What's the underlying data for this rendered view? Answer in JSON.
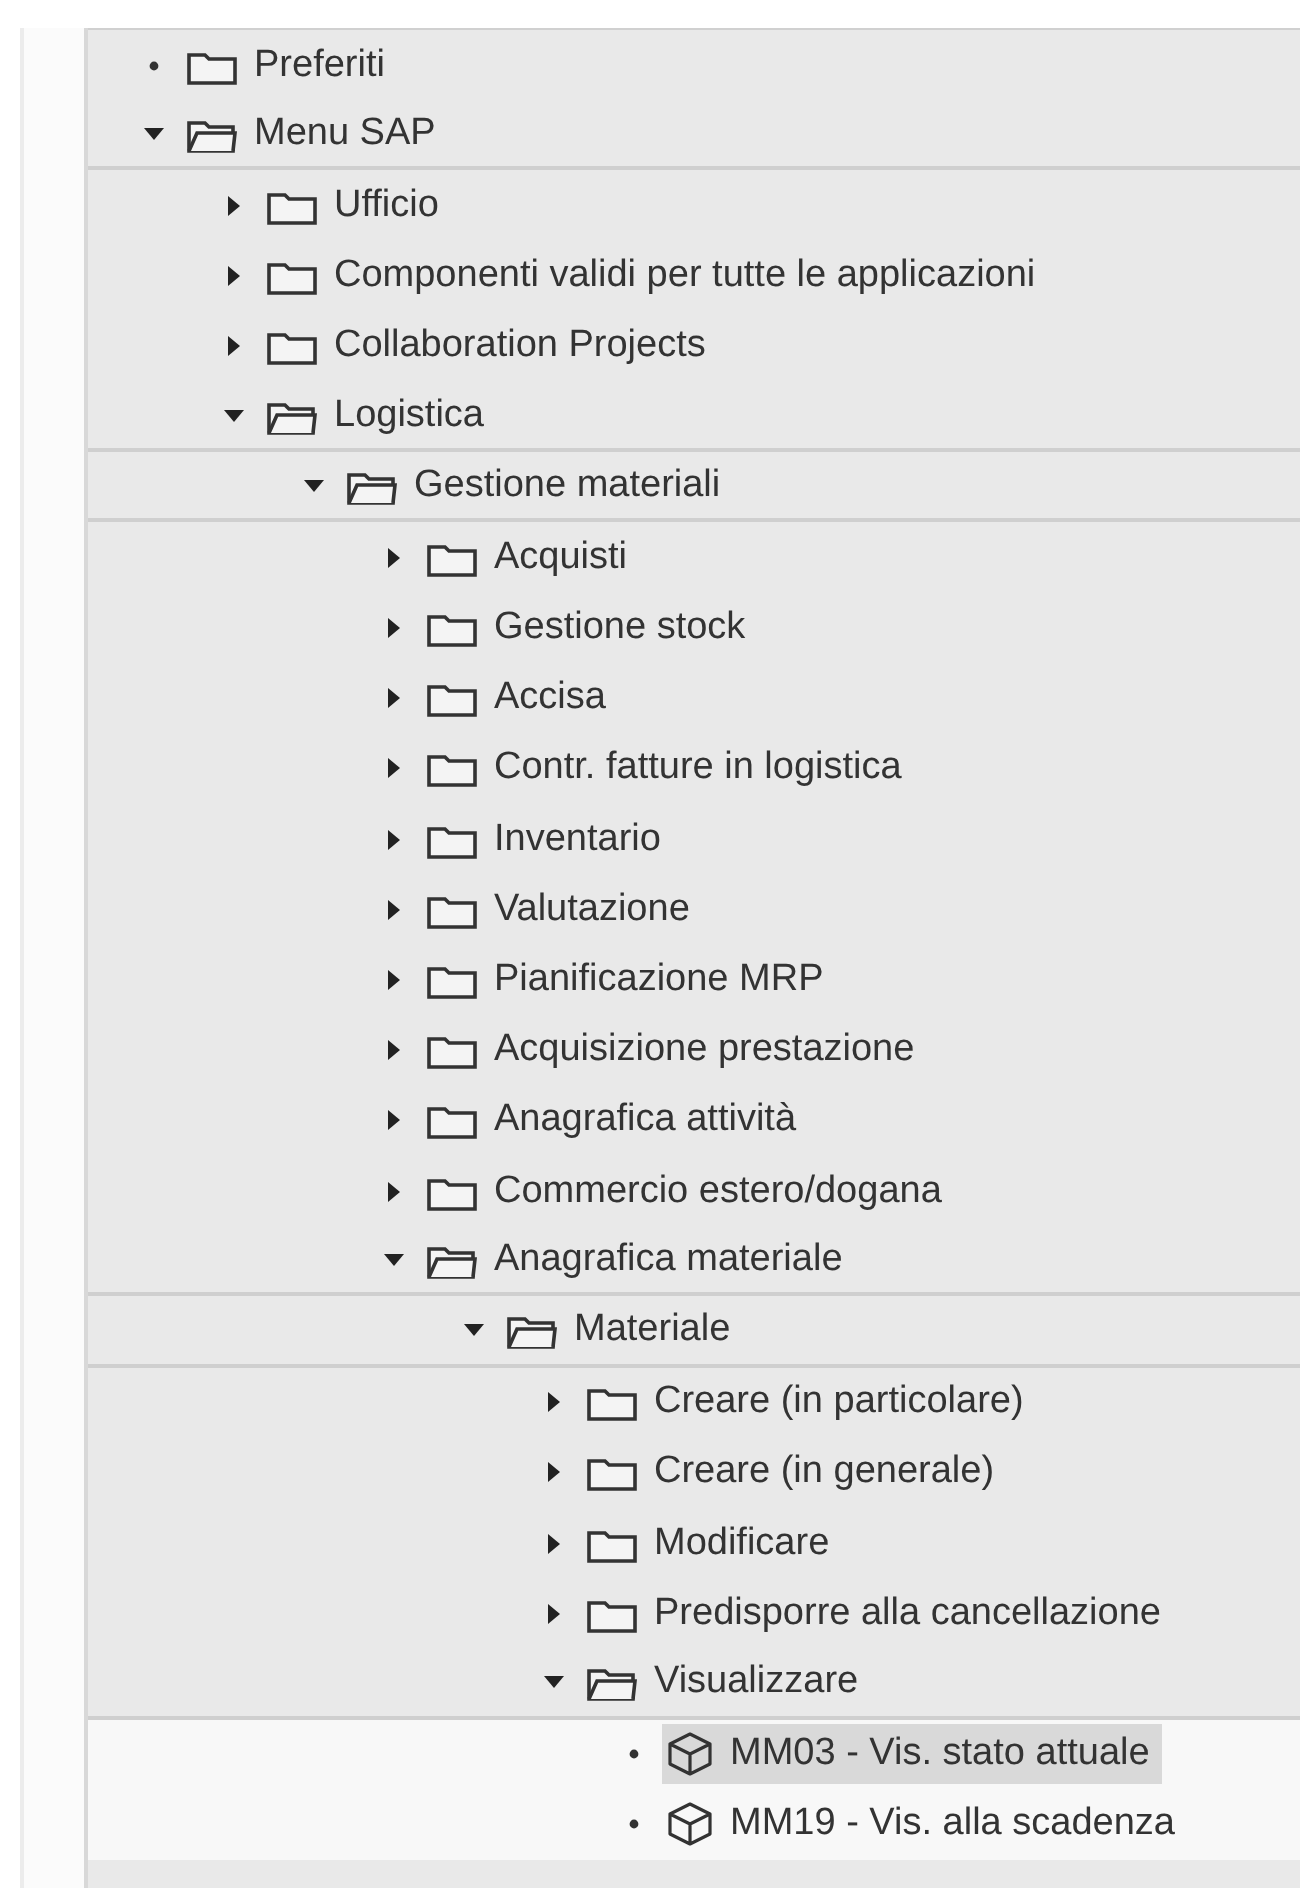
{
  "tree": [
    {
      "label": "Preferiti",
      "kind": "empty_folder",
      "selected": false
    },
    {
      "label": "Menu SAP",
      "kind": "folder",
      "expanded": true,
      "selected": false,
      "children": [
        {
          "label": "Ufficio",
          "kind": "folder",
          "expanded": false,
          "selected": false
        },
        {
          "label": "Componenti validi per tutte le applicazioni",
          "kind": "folder",
          "expanded": false,
          "selected": false
        },
        {
          "label": "Collaboration Projects",
          "kind": "folder",
          "expanded": false,
          "selected": false
        },
        {
          "label": "Logistica",
          "kind": "folder",
          "expanded": true,
          "selected": false,
          "children": [
            {
              "label": "Gestione materiali",
              "kind": "folder",
              "expanded": true,
              "selected": false,
              "children": [
                {
                  "label": "Acquisti",
                  "kind": "folder",
                  "expanded": false,
                  "selected": false
                },
                {
                  "label": "Gestione stock",
                  "kind": "folder",
                  "expanded": false,
                  "selected": false
                },
                {
                  "label": "Accisa",
                  "kind": "folder",
                  "expanded": false,
                  "selected": false
                },
                {
                  "label": "Contr. fatture in logistica",
                  "kind": "folder",
                  "expanded": false,
                  "selected": false
                },
                {
                  "label": "Inventario",
                  "kind": "folder",
                  "expanded": false,
                  "selected": false
                },
                {
                  "label": "Valutazione",
                  "kind": "folder",
                  "expanded": false,
                  "selected": false
                },
                {
                  "label": "Pianificazione MRP",
                  "kind": "folder",
                  "expanded": false,
                  "selected": false
                },
                {
                  "label": "Acquisizione prestazione",
                  "kind": "folder",
                  "expanded": false,
                  "selected": false
                },
                {
                  "label": "Anagrafica attività",
                  "kind": "folder",
                  "expanded": false,
                  "selected": false
                },
                {
                  "label": "Commercio estero/dogana",
                  "kind": "folder",
                  "expanded": false,
                  "selected": false
                },
                {
                  "label": "Anagrafica materiale",
                  "kind": "folder",
                  "expanded": true,
                  "selected": false,
                  "children": [
                    {
                      "label": "Materiale",
                      "kind": "folder",
                      "expanded": true,
                      "selected": false,
                      "children": [
                        {
                          "label": "Creare (in particolare)",
                          "kind": "folder",
                          "expanded": false,
                          "selected": false
                        },
                        {
                          "label": "Creare (in generale)",
                          "kind": "folder",
                          "expanded": false,
                          "selected": false
                        },
                        {
                          "label": "Modificare",
                          "kind": "folder",
                          "expanded": false,
                          "selected": false
                        },
                        {
                          "label": "Predisporre alla cancellazione",
                          "kind": "folder",
                          "expanded": false,
                          "selected": false
                        },
                        {
                          "label": "Visualizzare",
                          "kind": "folder",
                          "expanded": true,
                          "selected": false,
                          "children": [
                            {
                              "label": "MM03 - Vis. stato attuale",
                              "kind": "transaction",
                              "selected": true
                            },
                            {
                              "label": "MM19 - Vis. alla scadenza",
                              "kind": "transaction",
                              "selected": false
                            }
                          ]
                        }
                      ]
                    }
                  ]
                }
              ]
            }
          ]
        }
      ]
    }
  ]
}
